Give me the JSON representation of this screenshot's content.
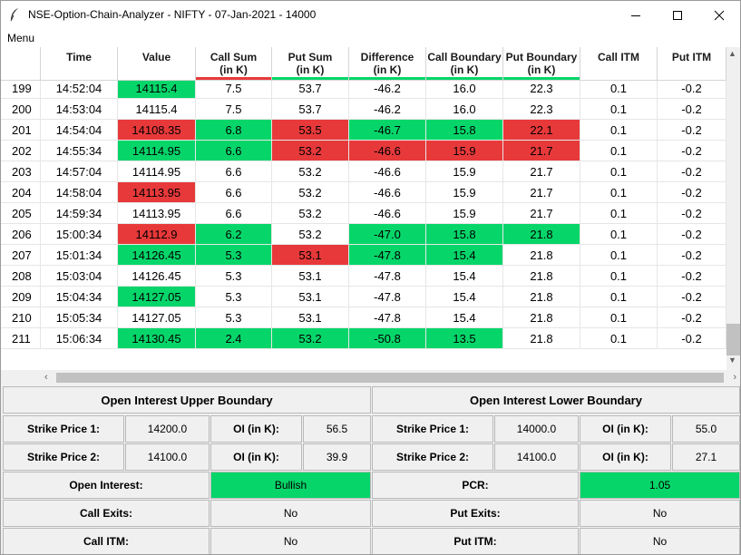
{
  "window": {
    "title": "NSE-Option-Chain-Analyzer - NIFTY - 07-Jan-2021 - 14000",
    "icon": "feather-icon",
    "controls": [
      "minimize-icon",
      "maximize-icon",
      "close-icon"
    ]
  },
  "menu": {
    "label": "Menu"
  },
  "table": {
    "headers": [
      {
        "line1": "",
        "line2": ""
      },
      {
        "line1": "Time",
        "line2": ""
      },
      {
        "line1": "Value",
        "line2": ""
      },
      {
        "line1": "Call Sum",
        "line2": "(in K)"
      },
      {
        "line1": "Put Sum",
        "line2": "(in K)"
      },
      {
        "line1": "Difference",
        "line2": "(in K)"
      },
      {
        "line1": "Call Boundary",
        "line2": "(in K)"
      },
      {
        "line1": "Put Boundary",
        "line2": "(in K)"
      },
      {
        "line1": "Call ITM",
        "line2": ""
      },
      {
        "line1": "Put ITM",
        "line2": ""
      }
    ],
    "header_indicators": [
      "",
      "",
      "",
      "red",
      "green",
      "green",
      "green",
      "green",
      "",
      ""
    ],
    "rows": [
      {
        "cells": [
          "199",
          "14:52:04",
          "14115.4",
          "7.5",
          "53.7",
          "-46.2",
          "16.0",
          "22.3",
          "0.1",
          "-0.2"
        ],
        "hl": [
          "",
          "",
          "green",
          "",
          "",
          "",
          "",
          "",
          "",
          ""
        ]
      },
      {
        "cells": [
          "200",
          "14:53:04",
          "14115.4",
          "7.5",
          "53.7",
          "-46.2",
          "16.0",
          "22.3",
          "0.1",
          "-0.2"
        ],
        "hl": [
          "",
          "",
          "",
          "",
          "",
          "",
          "",
          "",
          "",
          ""
        ]
      },
      {
        "cells": [
          "201",
          "14:54:04",
          "14108.35",
          "6.8",
          "53.5",
          "-46.7",
          "15.8",
          "22.1",
          "0.1",
          "-0.2"
        ],
        "hl": [
          "",
          "",
          "red",
          "green",
          "red",
          "green",
          "green",
          "red",
          "",
          ""
        ]
      },
      {
        "cells": [
          "202",
          "14:55:34",
          "14114.95",
          "6.6",
          "53.2",
          "-46.6",
          "15.9",
          "21.7",
          "0.1",
          "-0.2"
        ],
        "hl": [
          "",
          "",
          "green",
          "green",
          "red",
          "red",
          "red",
          "red",
          "",
          ""
        ]
      },
      {
        "cells": [
          "203",
          "14:57:04",
          "14114.95",
          "6.6",
          "53.2",
          "-46.6",
          "15.9",
          "21.7",
          "0.1",
          "-0.2"
        ],
        "hl": [
          "",
          "",
          "",
          "",
          "",
          "",
          "",
          "",
          "",
          ""
        ]
      },
      {
        "cells": [
          "204",
          "14:58:04",
          "14113.95",
          "6.6",
          "53.2",
          "-46.6",
          "15.9",
          "21.7",
          "0.1",
          "-0.2"
        ],
        "hl": [
          "",
          "",
          "red",
          "",
          "",
          "",
          "",
          "",
          "",
          ""
        ]
      },
      {
        "cells": [
          "205",
          "14:59:34",
          "14113.95",
          "6.6",
          "53.2",
          "-46.6",
          "15.9",
          "21.7",
          "0.1",
          "-0.2"
        ],
        "hl": [
          "",
          "",
          "",
          "",
          "",
          "",
          "",
          "",
          "",
          ""
        ]
      },
      {
        "cells": [
          "206",
          "15:00:34",
          "14112.9",
          "6.2",
          "53.2",
          "-47.0",
          "15.8",
          "21.8",
          "0.1",
          "-0.2"
        ],
        "hl": [
          "",
          "",
          "red",
          "green",
          "",
          "green",
          "green",
          "green",
          "",
          ""
        ]
      },
      {
        "cells": [
          "207",
          "15:01:34",
          "14126.45",
          "5.3",
          "53.1",
          "-47.8",
          "15.4",
          "21.8",
          "0.1",
          "-0.2"
        ],
        "hl": [
          "",
          "",
          "green",
          "green",
          "red",
          "green",
          "green",
          "",
          "",
          ""
        ]
      },
      {
        "cells": [
          "208",
          "15:03:04",
          "14126.45",
          "5.3",
          "53.1",
          "-47.8",
          "15.4",
          "21.8",
          "0.1",
          "-0.2"
        ],
        "hl": [
          "",
          "",
          "",
          "",
          "",
          "",
          "",
          "",
          "",
          ""
        ]
      },
      {
        "cells": [
          "209",
          "15:04:34",
          "14127.05",
          "5.3",
          "53.1",
          "-47.8",
          "15.4",
          "21.8",
          "0.1",
          "-0.2"
        ],
        "hl": [
          "",
          "",
          "green",
          "",
          "",
          "",
          "",
          "",
          "",
          ""
        ]
      },
      {
        "cells": [
          "210",
          "15:05:34",
          "14127.05",
          "5.3",
          "53.1",
          "-47.8",
          "15.4",
          "21.8",
          "0.1",
          "-0.2"
        ],
        "hl": [
          "",
          "",
          "",
          "",
          "",
          "",
          "",
          "",
          "",
          ""
        ]
      },
      {
        "cells": [
          "211",
          "15:06:34",
          "14130.45",
          "2.4",
          "53.2",
          "-50.8",
          "13.5",
          "21.8",
          "0.1",
          "-0.2"
        ],
        "hl": [
          "",
          "",
          "green",
          "green",
          "green",
          "green",
          "green",
          "",
          "",
          ""
        ]
      }
    ]
  },
  "colors": {
    "green": "#06d66a",
    "red": "#e8393a"
  },
  "upper": {
    "title": "Open Interest Upper Boundary",
    "strike1_label": "Strike Price 1:",
    "strike1_value": "14200.0",
    "oi1_label": "OI (in K):",
    "oi1_value": "56.5",
    "strike2_label": "Strike Price 2:",
    "strike2_value": "14100.0",
    "oi2_label": "OI (in K):",
    "oi2_value": "39.9"
  },
  "lower": {
    "title": "Open Interest Lower Boundary",
    "strike1_label": "Strike Price 1:",
    "strike1_value": "14000.0",
    "oi1_label": "OI (in K):",
    "oi1_value": "55.0",
    "strike2_label": "Strike Price 2:",
    "strike2_value": "14100.0",
    "oi2_label": "OI (in K):",
    "oi2_value": "27.1"
  },
  "summary": {
    "open_interest_label": "Open Interest:",
    "open_interest_value": "Bullish",
    "pcr_label": "PCR:",
    "pcr_value": "1.05",
    "call_exits_label": "Call Exits:",
    "call_exits_value": "No",
    "put_exits_label": "Put Exits:",
    "put_exits_value": "No",
    "call_itm_label": "Call ITM:",
    "call_itm_value": "No",
    "put_itm_label": "Put ITM:",
    "put_itm_value": "No"
  }
}
